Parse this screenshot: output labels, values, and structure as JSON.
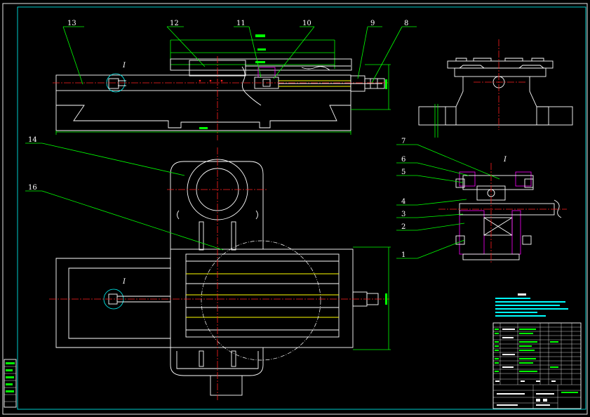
{
  "callouts": [
    "13",
    "12",
    "11",
    "10",
    "9",
    "8",
    "14",
    "16",
    "7",
    "6",
    "5",
    "4",
    "3",
    "2",
    "1"
  ],
  "view_marks": [
    "I",
    "I",
    "I"
  ],
  "colors": {
    "background": "#000000",
    "frame": "#00ffff",
    "outline": "#ffffff",
    "leader": "#00ff00",
    "centerline": "#ff2020",
    "hidden": "#ffff00",
    "hatch": "#ff00ff"
  }
}
